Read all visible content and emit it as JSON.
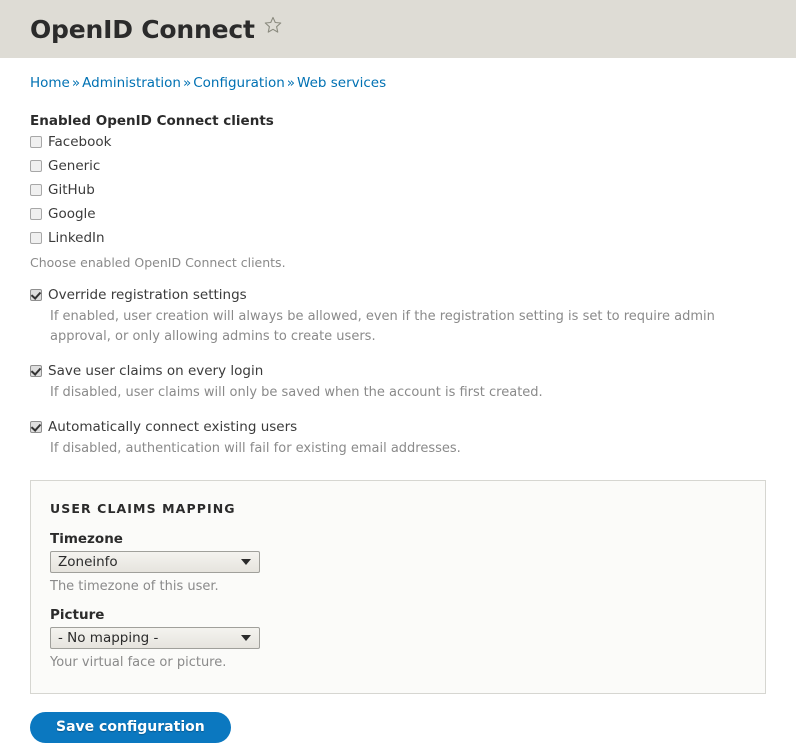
{
  "header": {
    "title": "OpenID Connect",
    "star_icon": "star-outline-icon"
  },
  "breadcrumb": {
    "separator": "»",
    "items": [
      {
        "label": "Home"
      },
      {
        "label": "Administration"
      },
      {
        "label": "Configuration"
      },
      {
        "label": "Web services"
      }
    ]
  },
  "clients": {
    "legend": "Enabled OpenID Connect clients",
    "items": [
      {
        "label": "Facebook",
        "checked": false
      },
      {
        "label": "Generic",
        "checked": false
      },
      {
        "label": "GitHub",
        "checked": false
      },
      {
        "label": "Google",
        "checked": false
      },
      {
        "label": "LinkedIn",
        "checked": false
      }
    ],
    "description": "Choose enabled OpenID Connect clients."
  },
  "settings": [
    {
      "label": "Override registration settings",
      "checked": true,
      "description": "If enabled, user creation will always be allowed, even if the registration setting is set to require admin approval, or only allowing admins to create users."
    },
    {
      "label": "Save user claims on every login",
      "checked": true,
      "description": "If disabled, user claims will only be saved when the account is first created."
    },
    {
      "label": "Automatically connect existing users",
      "checked": true,
      "description": "If disabled, authentication will fail for existing email addresses."
    }
  ],
  "claims_mapping": {
    "legend": "User claims mapping",
    "fields": [
      {
        "label": "Timezone",
        "value": "Zoneinfo",
        "description": "The timezone of this user."
      },
      {
        "label": "Picture",
        "value": "- No mapping -",
        "description": "Your virtual face or picture."
      }
    ]
  },
  "actions": {
    "save_label": "Save configuration"
  },
  "colors": {
    "header_band": "#dedcd5",
    "link": "#0071b3",
    "button": "#0b78c0",
    "help_text": "#8a8a8a",
    "fieldset_bg": "#fbfbf9"
  }
}
